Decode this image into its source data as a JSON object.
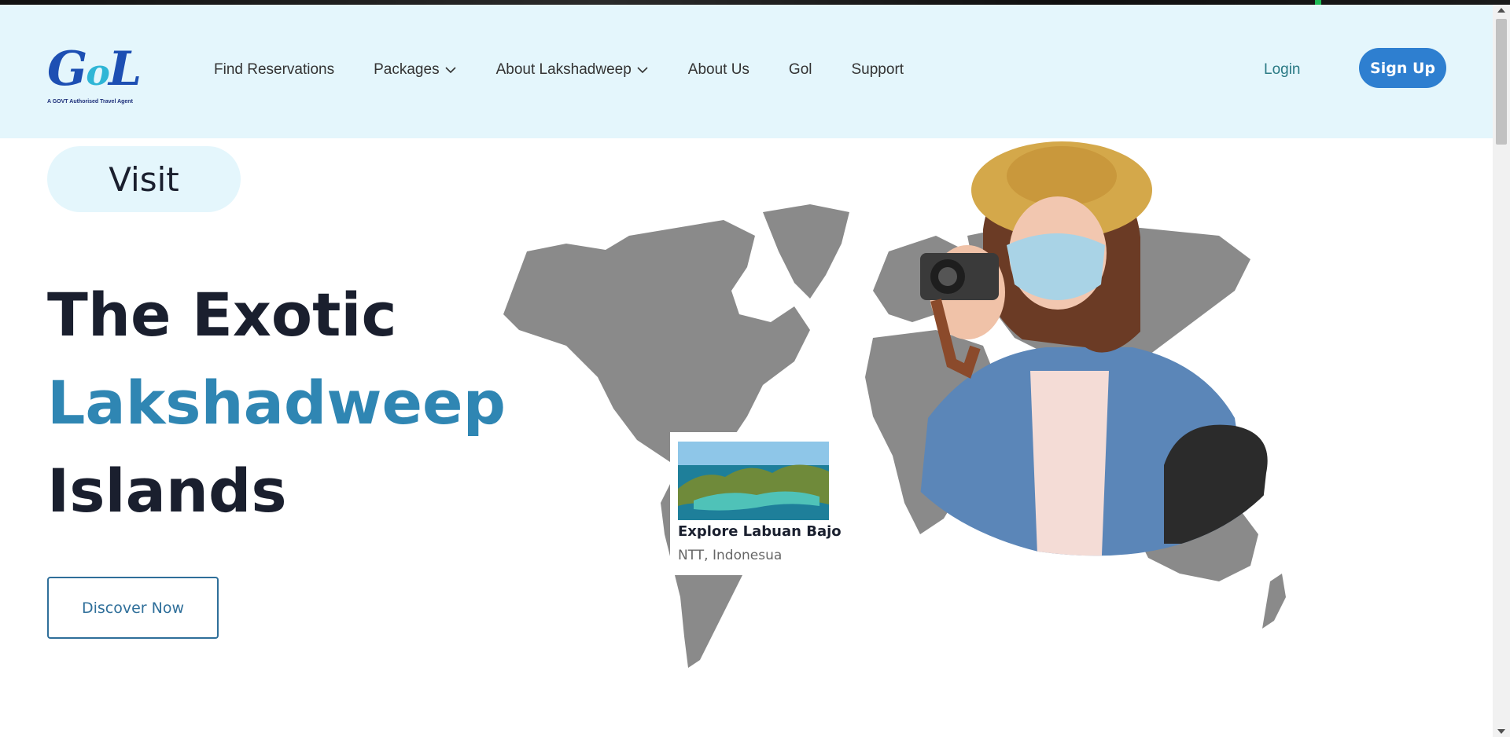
{
  "brand": {
    "logo_text": "GoL",
    "tagline": "A GOVT Authorised Travel Agent"
  },
  "nav": {
    "items": [
      {
        "label": "Find Reservations",
        "dropdown": false
      },
      {
        "label": "Packages",
        "dropdown": true
      },
      {
        "label": "About Lakshadweep",
        "dropdown": true
      },
      {
        "label": "About Us",
        "dropdown": false
      },
      {
        "label": "Gol",
        "dropdown": false
      },
      {
        "label": "Support",
        "dropdown": false
      }
    ],
    "login_label": "Login",
    "signup_label": "Sign Up"
  },
  "hero": {
    "pill_label": "Visit",
    "line1": "The Exotic",
    "line2": "Lakshadweep",
    "line3": "Islands",
    "cta_label": "Discover Now"
  },
  "card": {
    "title": "Explore Labuan Bajo",
    "subtitle": "NTT, Indonesua"
  },
  "colors": {
    "header_bg": "#e4f6fc",
    "accent": "#2f86b3",
    "signup_bg": "#2e7fd0",
    "map_gray": "#8a8a8a"
  }
}
